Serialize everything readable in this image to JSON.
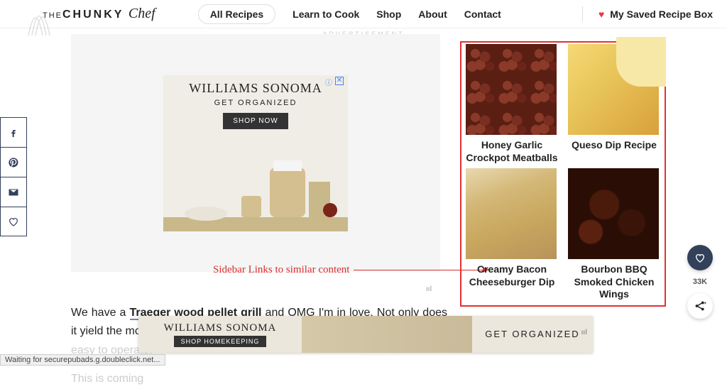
{
  "header": {
    "logo_the": "THE",
    "logo_chunky": "CHUNKY",
    "logo_chef": "Chef",
    "nav": {
      "all_recipes": "All Recipes",
      "learn": "Learn to Cook",
      "shop": "Shop",
      "about": "About",
      "contact": "Contact"
    },
    "saved": "My Saved Recipe Box"
  },
  "ad_label": "ADVERTISEMENT",
  "ad": {
    "title": "WILLIAMS SONOMA",
    "sub": "GET ORGANIZED",
    "cta": "SHOP NOW"
  },
  "annotation": "Sidebar Links to similar content",
  "article": {
    "p1a": "We have a ",
    "link": "Traeger wood pellet grill",
    "p1b": " and OMG I'm in love.  Not only does it yield the most amazing foods, but it's so incredibly ",
    "p2": "easy to operate.",
    "p3": "This is coming"
  },
  "sidebar": {
    "items": [
      {
        "title": "Honey Garlic Crockpot Meatballs"
      },
      {
        "title": "Queso Dip Recipe"
      },
      {
        "title": "Creamy Bacon Cheeseburger Dip"
      },
      {
        "title": "Bourbon BBQ Smoked Chicken Wings"
      }
    ]
  },
  "float": {
    "count": "33K"
  },
  "bottom": {
    "title": "WILLIAMS SONOMA",
    "cta": "SHOP HOMEKEEPING",
    "right": "GET ORGANIZED"
  },
  "status": "Waiting for securepubads.g.doubleclick.net...",
  "mediavine": "ııl"
}
